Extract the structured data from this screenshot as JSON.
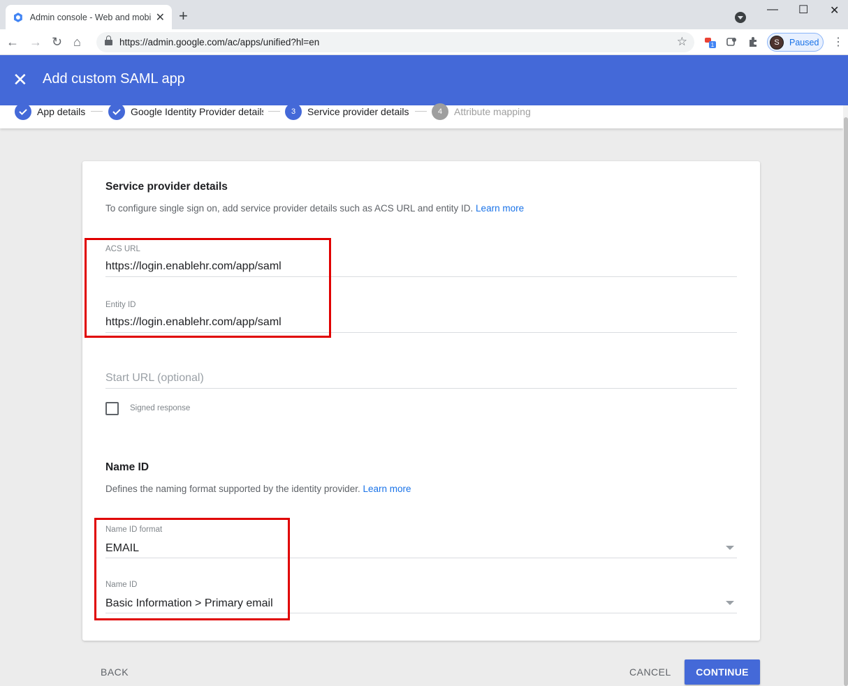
{
  "browser": {
    "tab_title": "Admin console - Web and mobile",
    "url": "https://admin.google.com/ac/apps/unified?hl=en",
    "profile_initial": "S",
    "profile_status": "Paused",
    "extension_badge": "1"
  },
  "header": {
    "title": "Add custom SAML app"
  },
  "stepper": [
    {
      "number": "",
      "label": "App details",
      "state": "done"
    },
    {
      "number": "",
      "label": "Google Identity Provider details",
      "state": "done"
    },
    {
      "number": "3",
      "label": "Service provider details",
      "state": "active"
    },
    {
      "number": "4",
      "label": "Attribute mapping",
      "state": "pending"
    }
  ],
  "service_provider": {
    "title": "Service provider details",
    "description": "To configure single sign on, add service provider details such as ACS URL and entity ID.",
    "learn_more": "Learn more",
    "acs_url_label": "ACS URL",
    "acs_url_value": "https://login.enablehr.com/app/saml",
    "entity_id_label": "Entity ID",
    "entity_id_value": "https://login.enablehr.com/app/saml",
    "start_url_placeholder": "Start URL (optional)",
    "signed_response_label": "Signed response",
    "signed_response_checked": false
  },
  "name_id": {
    "title": "Name ID",
    "description": "Defines the naming format supported by the identity provider.",
    "learn_more": "Learn more",
    "format_label": "Name ID format",
    "format_value": "EMAIL",
    "name_id_label": "Name ID",
    "name_id_value": "Basic Information > Primary email"
  },
  "footer": {
    "back": "BACK",
    "cancel": "CANCEL",
    "continue": "CONTINUE"
  },
  "colors": {
    "accent": "#4469d8",
    "highlight": "#e00000",
    "link": "#1a73e8"
  }
}
